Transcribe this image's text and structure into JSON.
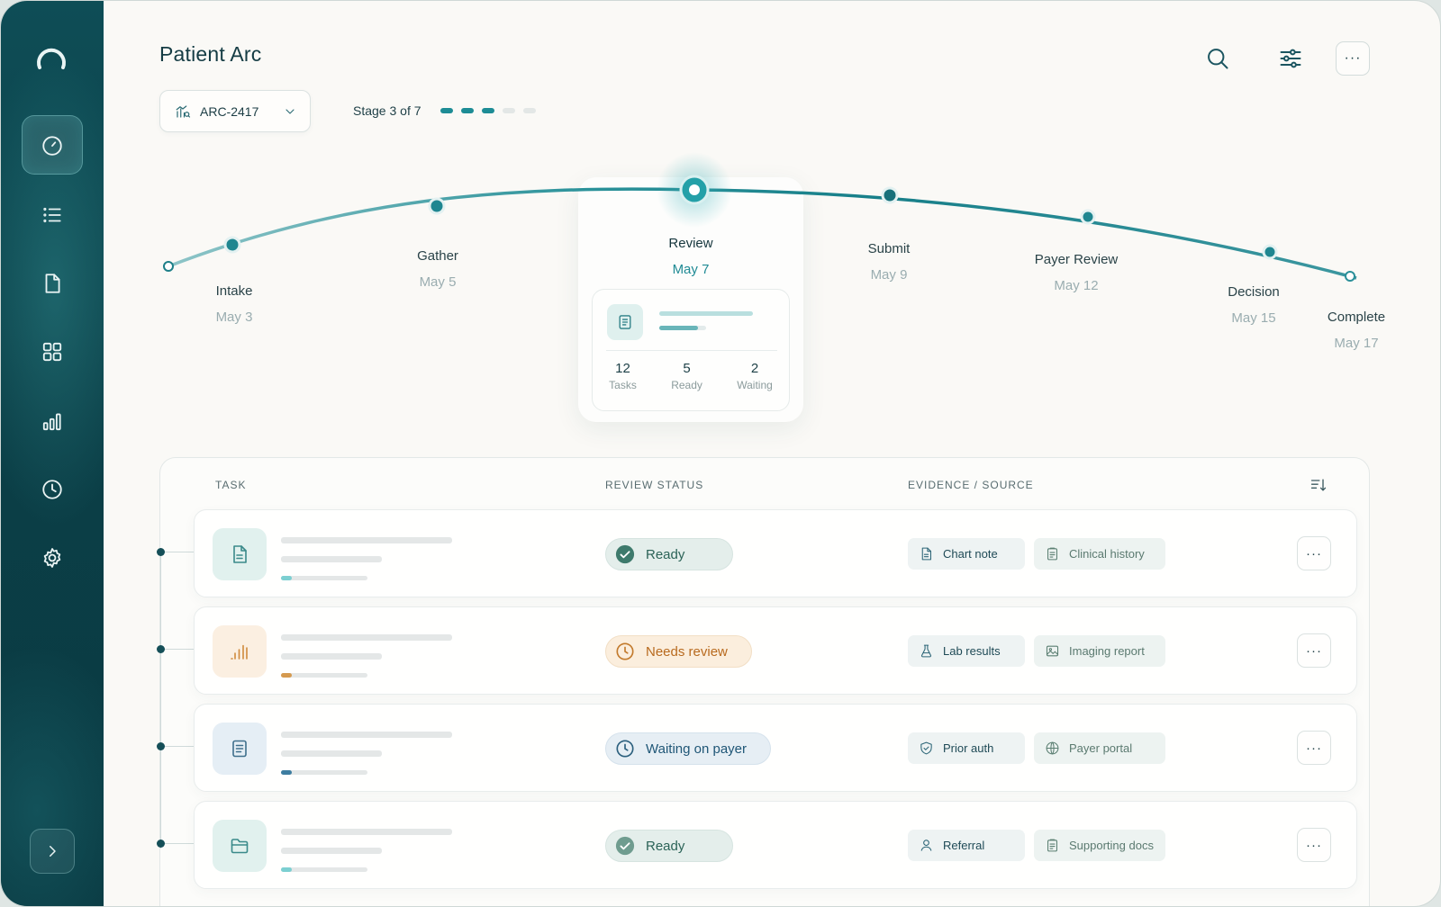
{
  "header": {
    "title": "Patient Arc",
    "case_id": "ARC-2417",
    "stage_label": "Stage 3 of 7",
    "stage_current": 3,
    "stage_total": 7,
    "more_label": "···"
  },
  "sidebar": {
    "items": [
      {
        "name": "dashboard",
        "icon": "gauge-icon",
        "active": true
      },
      {
        "name": "list",
        "icon": "list-icon",
        "active": false
      },
      {
        "name": "documents",
        "icon": "document-icon",
        "active": false
      },
      {
        "name": "apps",
        "icon": "grid-icon",
        "active": false
      },
      {
        "name": "analytics",
        "icon": "bar-chart-icon",
        "active": false
      },
      {
        "name": "history",
        "icon": "clock-icon",
        "active": false
      },
      {
        "name": "settings",
        "icon": "gear-icon",
        "active": false
      }
    ],
    "expand_icon": "chevron-right-icon"
  },
  "arc": {
    "stages": [
      {
        "name": "Intake",
        "date": "May 3"
      },
      {
        "name": "Gather",
        "date": "May 5"
      },
      {
        "name": "Review",
        "date": "May 7"
      },
      {
        "name": "Submit",
        "date": "May 9"
      },
      {
        "name": "Payer Review",
        "date": "May 12"
      },
      {
        "name": "Decision",
        "date": "May 15"
      },
      {
        "name": "Complete",
        "date": "May 17"
      }
    ],
    "current_card": {
      "stats": [
        {
          "value": "12",
          "label": "Tasks"
        },
        {
          "value": "5",
          "label": "Ready"
        },
        {
          "value": "2",
          "label": "Waiting"
        }
      ]
    }
  },
  "table": {
    "columns": [
      "TASK",
      "REVIEW STATUS",
      "EVIDENCE / SOURCE"
    ],
    "rows": [
      {
        "icon": "document-icon",
        "status": "Ready",
        "status_kind": "ready",
        "evidence": [
          {
            "label": "Chart note",
            "icon": "file-icon"
          },
          {
            "label": "Clinical history",
            "icon": "clipboard-icon"
          }
        ],
        "more": "···"
      },
      {
        "icon": "bar-chart-icon",
        "status": "Needs review",
        "status_kind": "needs",
        "evidence": [
          {
            "label": "Lab results",
            "icon": "flask-icon"
          },
          {
            "label": "Imaging report",
            "icon": "image-icon"
          }
        ],
        "more": "···"
      },
      {
        "icon": "clipboard-icon",
        "status": "Waiting on payer",
        "status_kind": "waiting",
        "evidence": [
          {
            "label": "Prior auth",
            "icon": "shield-icon"
          },
          {
            "label": "Payer portal",
            "icon": "globe-icon"
          }
        ],
        "more": "···"
      },
      {
        "icon": "folder-icon",
        "status": "Ready",
        "status_kind": "ready",
        "evidence": [
          {
            "label": "Referral",
            "icon": "user-icon"
          },
          {
            "label": "Supporting docs",
            "icon": "clipboard-icon"
          }
        ],
        "more": "···"
      }
    ]
  },
  "colors": {
    "accent": "#1d8c95",
    "sidebar": "#0b3f47",
    "ready": "#2b6357",
    "needs_review": "#b86a1e",
    "waiting": "#1f5676"
  }
}
